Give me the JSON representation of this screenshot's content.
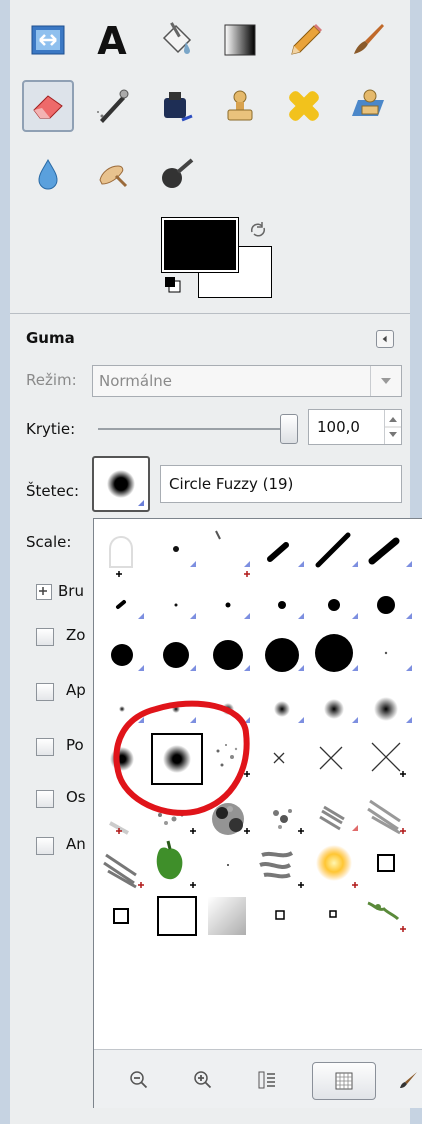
{
  "tool_options": {
    "title": "Guma",
    "mode_label": "Režim:",
    "mode_value": "Normálne",
    "opacity_label": "Krytie:",
    "opacity_value": "100,0",
    "opacity_level_percent": 100,
    "brush_label": "Štetec:",
    "brush_name": "Circle Fuzzy (19)",
    "scale_label": "Scale:",
    "brush_dynamics_label": "Bru",
    "options_truncated": [
      "Zo",
      "Ap",
      "Po",
      "Os",
      "An"
    ]
  },
  "toolbox": {
    "tools": [
      "align-icon",
      "text-icon",
      "bucket-fill-icon",
      "blend-icon",
      "pencil-icon",
      "paintbrush-icon",
      "eraser-icon",
      "airbrush-icon",
      "ink-icon",
      "clone-icon",
      "heal-icon",
      "perspective-clone-icon",
      "blur-icon",
      "smudge-icon",
      "dodge-burn-icon"
    ],
    "active_tool": "eraser-icon",
    "foreground_color": "#000000",
    "background_color": "#ffffff"
  },
  "brush_popup": {
    "selected_brush": "Circle Fuzzy (19)",
    "buttons": [
      "zoom-out-icon",
      "zoom-in-icon",
      "list-view-icon",
      "grid-view-icon",
      "edit-brush-icon"
    ],
    "annotation_color": "#e0141a"
  }
}
